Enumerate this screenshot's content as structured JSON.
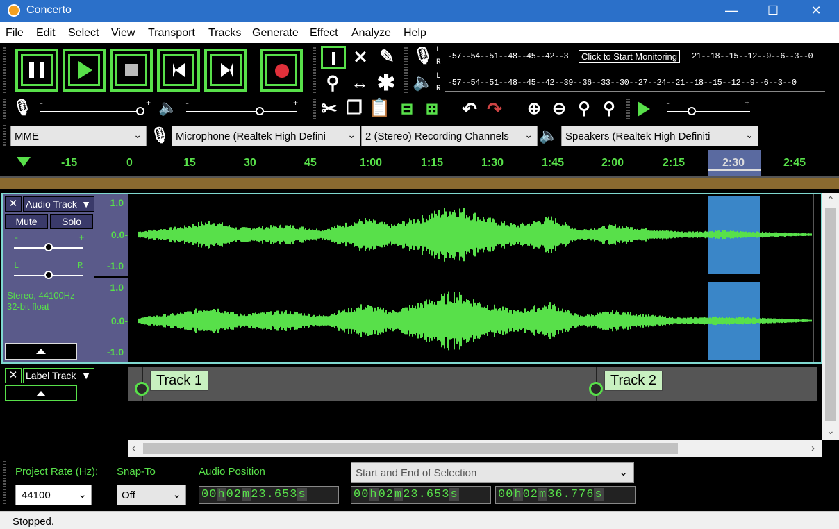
{
  "window": {
    "title": "Concerto",
    "minimize": "—",
    "maximize": "☐",
    "close": "✕"
  },
  "menu": [
    {
      "label": "File"
    },
    {
      "label": "Edit"
    },
    {
      "label": "Select"
    },
    {
      "label": "View"
    },
    {
      "label": "Transport"
    },
    {
      "label": "Tracks"
    },
    {
      "label": "Generate"
    },
    {
      "label": "Effect"
    },
    {
      "label": "Analyze"
    },
    {
      "label": "Help"
    }
  ],
  "meters": {
    "record_scale": "-57--54--51--48--45--42--3",
    "monitor_tooltip": "Click to Start Monitoring",
    "record_scale_tail": "21--18--15--12--9--6--3--0",
    "play_scale": "-57--54--51--48--45--42--39--36--33--30--27--24--21--18--15--12--9--6--3--0",
    "L": "L",
    "R": "R",
    "minus": "-",
    "plus": "+"
  },
  "devices": {
    "host": "MME",
    "recording_device": "Microphone (Realtek High Defini",
    "channels": "2 (Stereo) Recording Channels",
    "playback_device": "Speakers (Realtek High Definiti"
  },
  "timeline": {
    "ticks": [
      "-15",
      "0",
      "15",
      "30",
      "45",
      "1:00",
      "1:15",
      "1:30",
      "1:45",
      "2:00",
      "2:15",
      "2:30",
      "2:45"
    ]
  },
  "audio_track": {
    "name": "Audio Track",
    "mute": "Mute",
    "solo": "Solo",
    "gain_minus": "-",
    "gain_plus": "+",
    "pan_l": "L",
    "pan_r": "R",
    "info_line1": "Stereo, 44100Hz",
    "info_line2": "32-bit float",
    "scale": {
      "top": "1.0",
      "mid": "0.0-",
      "bottom": "-1.0",
      "top2": "1.0",
      "mid2": "0.0-",
      "bottom2": "-1.0"
    }
  },
  "label_track": {
    "name": "Label Track",
    "labels": [
      "Track 1",
      "Track 2"
    ]
  },
  "selection_toolbar": {
    "project_rate_label": "Project Rate (Hz):",
    "project_rate": "44100",
    "snap_label": "Snap-To",
    "snap_value": "Off",
    "audio_position_label": "Audio Position",
    "selection_mode": "Start and End of Selection",
    "audio_position": {
      "h": "00",
      "m": "02",
      "s": "23.653"
    },
    "sel_start": {
      "h": "00",
      "m": "02",
      "s": "23.653"
    },
    "sel_end": {
      "h": "00",
      "m": "02",
      "s": "36.776"
    }
  },
  "status": {
    "text": "Stopped."
  },
  "colors": {
    "accent": "#58e04a",
    "titlebar": "#2b70c9",
    "selection": "#3a86c8",
    "panel": "#5a5a8a"
  }
}
